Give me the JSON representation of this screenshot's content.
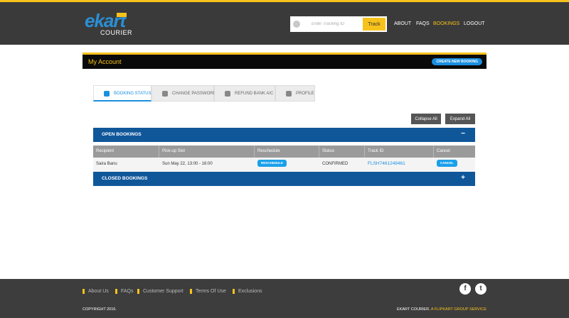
{
  "header": {
    "logo_text": "ekart",
    "logo_sub": "COURIER",
    "tracking_placeholder": "Enter Tracking ID",
    "track_button": "Track",
    "nav": [
      "ABOUT",
      "FAQS",
      "BOOKINGS",
      "LOGOUT"
    ],
    "active_nav": "BOOKINGS"
  },
  "account": {
    "title": "My Account",
    "create_button": "CREATE NEW BOOKING"
  },
  "tabs": [
    {
      "label": "BOOKING STATUS",
      "icon": "suitcase-icon",
      "active": true
    },
    {
      "label": "CHANGE PASSWORD",
      "icon": "key-icon",
      "active": false
    },
    {
      "label": "REFUND BANK A/C",
      "icon": "bank-icon",
      "active": false
    },
    {
      "label": "PROFILE",
      "icon": "gear-icon",
      "active": false
    }
  ],
  "actions": {
    "collapse": "Collapse All",
    "expand": "Expand All"
  },
  "open_bookings": {
    "title": "OPEN BOOKINGS",
    "toggle": "−",
    "columns": [
      "Recipient",
      "Pick-up Slot",
      "Reschedule",
      "Status",
      "Track ID",
      "Cancel"
    ],
    "rows": [
      {
        "recipient": "Saira Banu",
        "slot": "Sun May 22, 13:00 - 16:00",
        "reschedule": "RESCHEDULE",
        "status": "CONFIRMED",
        "track_id": "FLSH7461249461",
        "cancel": "CANCEL"
      }
    ]
  },
  "closed_bookings": {
    "title": "CLOSED BOOKINGS",
    "toggle": "+"
  },
  "footer": {
    "links": [
      "About Us",
      "FAQs",
      "Customer Support",
      "Terms Of Use",
      "Exclusions"
    ],
    "copyright": "COPYRIGHT 2016.",
    "service_prefix": "EKART COURIER.",
    "service_brand": "A FLIPKART GROUP SERVICE"
  },
  "colors": {
    "accent": "#f7c21b",
    "primary_blue": "#10579a",
    "link_blue": "#1a8fe0",
    "header_bg": "#3a3a3a"
  }
}
